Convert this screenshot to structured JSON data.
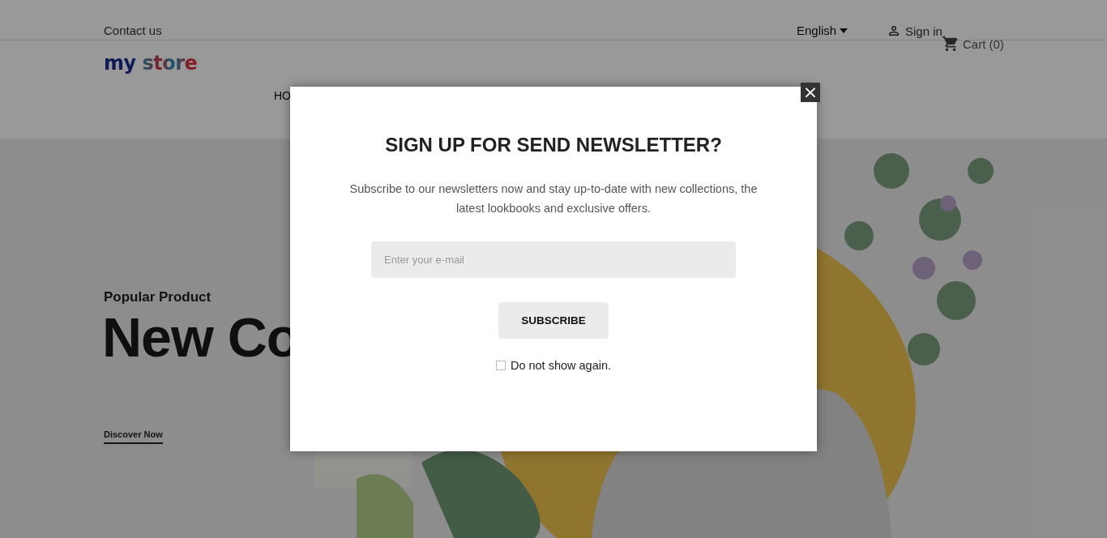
{
  "header": {
    "contact": "Contact us",
    "language": "English",
    "sign_in": "Sign in",
    "cart": "Cart (0)",
    "logo": "my store",
    "nav": [
      "HO"
    ]
  },
  "hero": {
    "subtitle": "Popular Product",
    "title": "New Co",
    "link": "Discover Now"
  },
  "modal": {
    "title": "SIGN UP FOR SEND NEWSLETTER?",
    "text": "Subscribe to our newsletters now and stay up-to-date with new collections, the latest lookbooks and exclusive offers.",
    "email": {
      "placeholder": "Enter your e-mail"
    },
    "button": "SUBSCRIBE",
    "dont_show": {
      "label": "Do not show again.",
      "checked": false
    },
    "close": "×"
  }
}
